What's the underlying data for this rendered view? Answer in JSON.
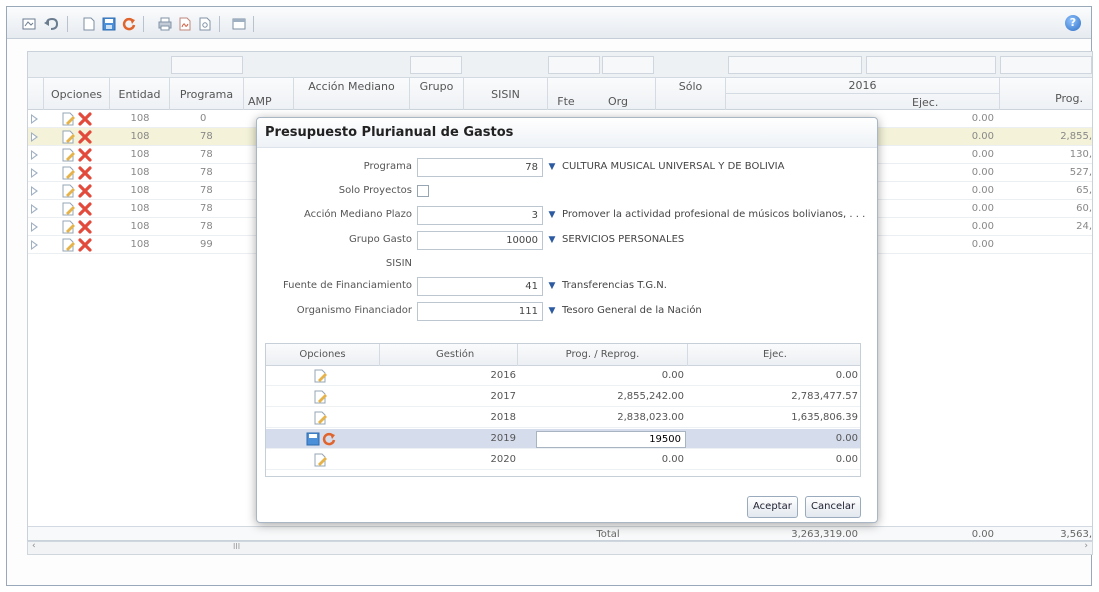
{
  "toolbar": {
    "icons": [
      "export-icon",
      "undo-icon",
      "new-icon",
      "save-icon",
      "refresh-icon",
      "print-icon",
      "pdf-icon",
      "preview-icon",
      "window-icon",
      "help-icon"
    ],
    "help_label": "?"
  },
  "grid": {
    "columns": {
      "opciones": "Opciones",
      "entidad": "Entidad",
      "programa": "Programa",
      "amp": "AMP",
      "accion": "Acción Mediano",
      "grupo": "Grupo",
      "sisin": "SISIN",
      "fte": "Fte",
      "org": "Org",
      "solo": "Sólo",
      "year": "2016",
      "ejec": "Ejec.",
      "prog": "Prog."
    },
    "rows": [
      {
        "entidad": "108",
        "programa": "0",
        "ejec": "0.00",
        "prog": ""
      },
      {
        "entidad": "108",
        "programa": "78",
        "ejec": "0.00",
        "prog": "2,855,"
      },
      {
        "entidad": "108",
        "programa": "78",
        "ejec": "0.00",
        "prog": "130,"
      },
      {
        "entidad": "108",
        "programa": "78",
        "ejec": "0.00",
        "prog": "527,"
      },
      {
        "entidad": "108",
        "programa": "78",
        "ejec": "0.00",
        "prog": "65,"
      },
      {
        "entidad": "108",
        "programa": "78",
        "ejec": "0.00",
        "prog": "60,"
      },
      {
        "entidad": "108",
        "programa": "78",
        "ejec": "0.00",
        "prog": "24,"
      },
      {
        "entidad": "108",
        "programa": "99",
        "ejec": "0.00",
        "prog": ""
      }
    ],
    "totals": {
      "label": "Total",
      "prog2016": "3,263,319.00",
      "ejec": "0.00",
      "prog": "3,563,"
    },
    "scroll_marker": "III"
  },
  "modal": {
    "title": "Presupuesto Plurianual de Gastos",
    "fields": {
      "programa": {
        "label": "Programa",
        "value": "78",
        "desc": "CULTURA MUSICAL UNIVERSAL Y DE BOLIVIA"
      },
      "solo_proyectos": {
        "label": "Solo Proyectos"
      },
      "accion": {
        "label": "Acción Mediano Plazo",
        "value": "3",
        "desc": "Promover la actividad profesional de músicos bolivianos, . . ."
      },
      "grupo": {
        "label": "Grupo Gasto",
        "value": "10000",
        "desc": "SERVICIOS PERSONALES"
      },
      "sisin": {
        "label": "SISIN"
      },
      "fuente": {
        "label": "Fuente de Financiamiento",
        "value": "41",
        "desc": "Transferencias T.G.N."
      },
      "organismo": {
        "label": "Organismo Financiador",
        "value": "111",
        "desc": "Tesoro General de la Nación"
      }
    },
    "table": {
      "headers": {
        "opciones": "Opciones",
        "gestion": "Gestión",
        "prog": "Prog. / Reprog.",
        "ejec": "Ejec."
      },
      "rows": [
        {
          "gestion": "2016",
          "prog": "0.00",
          "ejec": "0.00"
        },
        {
          "gestion": "2017",
          "prog": "2,855,242.00",
          "ejec": "2,783,477.57"
        },
        {
          "gestion": "2018",
          "prog": "2,838,023.00",
          "ejec": "1,635,806.39"
        },
        {
          "gestion": "2019",
          "prog": "19500",
          "ejec": "0.00"
        },
        {
          "gestion": "2020",
          "prog": "0.00",
          "ejec": "0.00"
        }
      ]
    },
    "buttons": {
      "ok": "Aceptar",
      "cancel": "Cancelar"
    }
  }
}
